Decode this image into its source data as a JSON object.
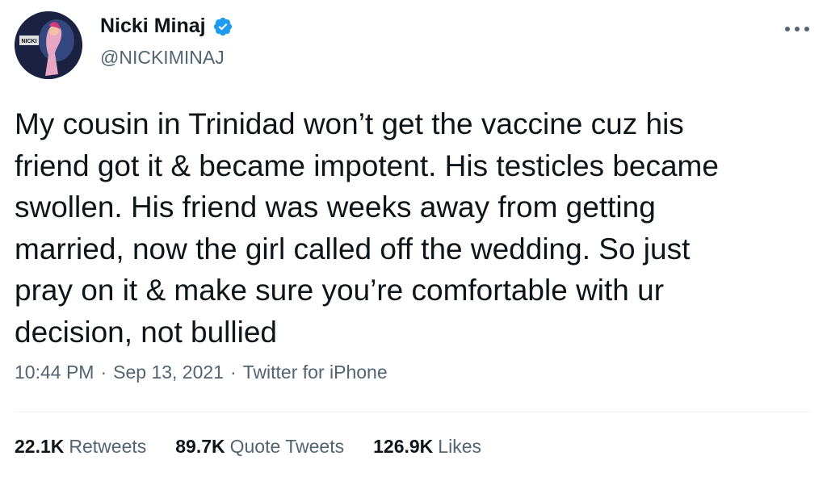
{
  "author": {
    "display_name": "Nicki Minaj",
    "handle": "@NICKIMINAJ",
    "verified": true,
    "avatar_text": "NICKI MINAJ"
  },
  "tweet": {
    "text": "My cousin in Trinidad won’t get the vaccine cuz his\nfriend got it & became impotent. His testicles became\nswollen. His friend was weeks away from getting\nmarried, now the girl called off the wedding. So just\npray on it & make sure you’re comfortable with ur\ndecision, not bullied"
  },
  "meta": {
    "time": "10:44 PM",
    "sep1": "·",
    "date": "Sep 13, 2021",
    "sep2": "·",
    "source": "Twitter for iPhone"
  },
  "stats": {
    "retweets_count": "22.1K",
    "retweets_label": "Retweets",
    "quotes_count": "89.7K",
    "quotes_label": "Quote Tweets",
    "likes_count": "126.9K",
    "likes_label": "Likes"
  },
  "icons": {
    "verified": "verified-badge-icon",
    "more": "more-options-icon"
  },
  "colors": {
    "text_primary": "#0f1419",
    "text_secondary": "#536471",
    "verified_blue": "#1d9bf0",
    "divider": "#eff3f4"
  }
}
